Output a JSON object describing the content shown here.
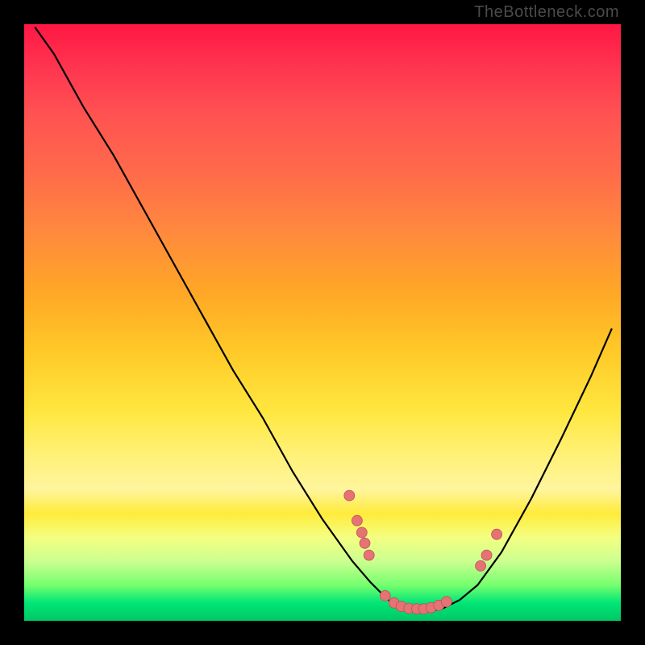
{
  "watermark": "TheBottleneck.com",
  "chart_data": {
    "type": "line",
    "title": "",
    "xlabel": "",
    "ylabel": "",
    "xlim": [
      0,
      1
    ],
    "ylim": [
      0,
      1
    ],
    "curve": [
      {
        "x": 0.018,
        "y": 0.995
      },
      {
        "x": 0.05,
        "y": 0.95
      },
      {
        "x": 0.1,
        "y": 0.86
      },
      {
        "x": 0.15,
        "y": 0.78
      },
      {
        "x": 0.2,
        "y": 0.69
      },
      {
        "x": 0.25,
        "y": 0.6
      },
      {
        "x": 0.3,
        "y": 0.51
      },
      {
        "x": 0.35,
        "y": 0.42
      },
      {
        "x": 0.4,
        "y": 0.34
      },
      {
        "x": 0.45,
        "y": 0.25
      },
      {
        "x": 0.5,
        "y": 0.17
      },
      {
        "x": 0.55,
        "y": 0.1
      },
      {
        "x": 0.58,
        "y": 0.065
      },
      {
        "x": 0.61,
        "y": 0.035
      },
      {
        "x": 0.64,
        "y": 0.02
      },
      {
        "x": 0.67,
        "y": 0.015
      },
      {
        "x": 0.7,
        "y": 0.02
      },
      {
        "x": 0.73,
        "y": 0.035
      },
      {
        "x": 0.76,
        "y": 0.06
      },
      {
        "x": 0.8,
        "y": 0.115
      },
      {
        "x": 0.85,
        "y": 0.205
      },
      {
        "x": 0.9,
        "y": 0.305
      },
      {
        "x": 0.95,
        "y": 0.41
      },
      {
        "x": 0.985,
        "y": 0.49
      }
    ],
    "points": [
      {
        "x": 0.545,
        "y": 0.21
      },
      {
        "x": 0.558,
        "y": 0.168
      },
      {
        "x": 0.566,
        "y": 0.148
      },
      {
        "x": 0.571,
        "y": 0.13
      },
      {
        "x": 0.578,
        "y": 0.11
      },
      {
        "x": 0.605,
        "y": 0.042
      },
      {
        "x": 0.62,
        "y": 0.03
      },
      {
        "x": 0.632,
        "y": 0.024
      },
      {
        "x": 0.645,
        "y": 0.021
      },
      {
        "x": 0.658,
        "y": 0.02
      },
      {
        "x": 0.67,
        "y": 0.02
      },
      {
        "x": 0.682,
        "y": 0.022
      },
      {
        "x": 0.695,
        "y": 0.026
      },
      {
        "x": 0.708,
        "y": 0.032
      },
      {
        "x": 0.765,
        "y": 0.092
      },
      {
        "x": 0.775,
        "y": 0.11
      },
      {
        "x": 0.792,
        "y": 0.145
      }
    ],
    "point_color": "#e57373",
    "curve_color": "#000000",
    "gradient_top": "#ff1744",
    "gradient_bottom": "#00c766"
  }
}
